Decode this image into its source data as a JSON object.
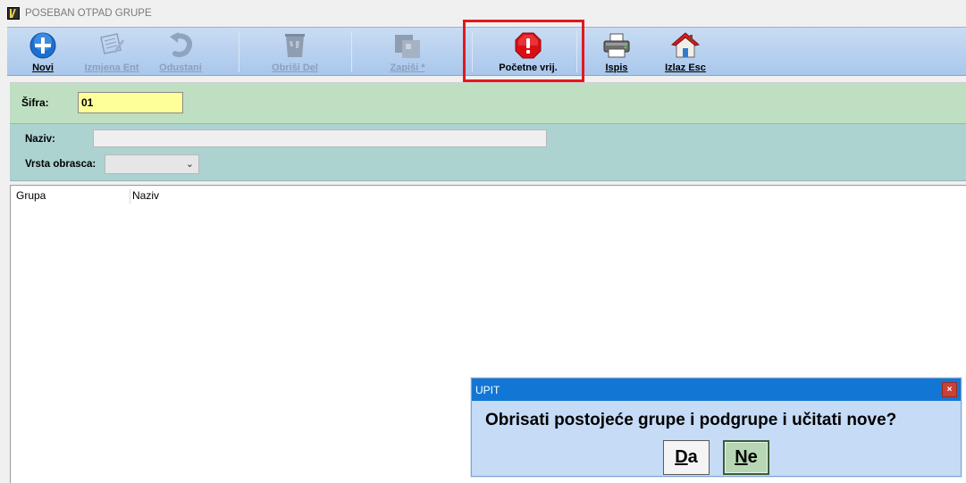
{
  "window": {
    "title": "POSEBAN OTPAD GRUPE"
  },
  "toolbar": {
    "novi": "Novi",
    "izmjena": "Izmjena Ent",
    "odustani": "Odustani",
    "obrisi": "Obriši Del",
    "zapisi": "Zapiši *",
    "pocetne": "Početne vrij.",
    "ispis": "Ispis",
    "izlaz": "Izlaz Esc"
  },
  "form": {
    "sifra_label": "Šifra:",
    "sifra_value": "01",
    "naziv_label": "Naziv:",
    "naziv_value": "",
    "vrsta_label": "Vrsta obrasca:",
    "vrsta_value": ""
  },
  "grid": {
    "columns": [
      "Grupa",
      "Naziv"
    ]
  },
  "dialog": {
    "title": "UPIT",
    "message": "Obrisati postojeće grupe i podgrupe i učitati nove?",
    "yes_prefix": "D",
    "yes_rest": "a",
    "no_prefix": "N",
    "no_rest": "e",
    "close": "×"
  },
  "colors": {
    "toolbar": "#b7d1f0",
    "green_panel": "#bfdfc2",
    "teal_panel": "#acd3d0",
    "sifra_field": "#ffff99",
    "dialog_title": "#1276d4",
    "highlight": "#e0191e"
  }
}
